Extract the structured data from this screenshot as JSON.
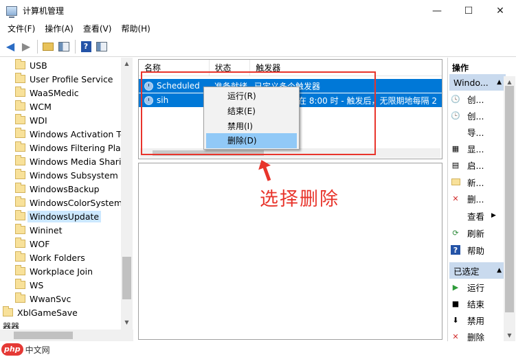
{
  "window": {
    "title": "计算机管理",
    "minimize_glyph": "—",
    "maximize_glyph": "☐",
    "close_glyph": "✕"
  },
  "menu": [
    "文件(F)",
    "操作(A)",
    "查看(V)",
    "帮助(H)"
  ],
  "toolbar": {
    "icons": [
      "back-arrow-icon",
      "forward-arrow-icon",
      "folder-up-icon",
      "show-hide-tree-icon",
      "help-icon",
      "properties-panel-icon"
    ],
    "help_glyph": "?"
  },
  "tree": {
    "items": [
      {
        "label": "USB"
      },
      {
        "label": "User Profile Service"
      },
      {
        "label": "WaaSMedic"
      },
      {
        "label": "WCM"
      },
      {
        "label": "WDI"
      },
      {
        "label": "Windows Activation Tec"
      },
      {
        "label": "Windows Filtering Platf"
      },
      {
        "label": "Windows Media Sharin"
      },
      {
        "label": "Windows Subsystem Fo"
      },
      {
        "label": "WindowsBackup"
      },
      {
        "label": "WindowsColorSystem"
      },
      {
        "label": "WindowsUpdate",
        "selected": true
      },
      {
        "label": "Wininet"
      },
      {
        "label": "WOF"
      },
      {
        "label": "Work Folders"
      },
      {
        "label": "Workplace Join"
      },
      {
        "label": "WS"
      },
      {
        "label": "WwanSvc"
      },
      {
        "label": "XblGameSave"
      }
    ],
    "cut_label": "器器"
  },
  "task_list": {
    "columns": [
      "名称",
      "状态",
      "触发器"
    ],
    "rows": [
      {
        "name": "Scheduled ...",
        "status": "准备就绪",
        "trigger": "已定义多个触发器"
      },
      {
        "name": "sih",
        "status": "",
        "trigger": "在 8:00 时 - 触发后，无限期地每隔 2"
      }
    ]
  },
  "context_menu": {
    "items": [
      {
        "label": "运行(R)"
      },
      {
        "label": "结束(E)"
      },
      {
        "label": "禁用(I)"
      },
      {
        "label": "删除(D)",
        "active": true
      }
    ]
  },
  "annotation": {
    "text": "选择删除",
    "color": "#e8342b"
  },
  "actions": {
    "title": "操作",
    "section1": {
      "header": "Windo...",
      "items": [
        {
          "label": "创...",
          "icon": "create-basic-task-icon"
        },
        {
          "label": "创...",
          "icon": "create-task-icon"
        },
        {
          "label": "导...",
          "icon": "import-icon"
        },
        {
          "label": "显...",
          "icon": "display-running-icon"
        },
        {
          "label": "启...",
          "icon": "enable-history-icon"
        },
        {
          "label": "新...",
          "icon": "new-folder-icon"
        },
        {
          "label": "删...",
          "icon": "delete-folder-icon"
        },
        {
          "label": "查看",
          "icon": "view-icon"
        },
        {
          "label": "刷新",
          "icon": "refresh-icon"
        },
        {
          "label": "帮助",
          "icon": "help-icon"
        }
      ]
    },
    "section2": {
      "header": "已选定",
      "items": [
        {
          "label": "运行",
          "icon": "run-icon"
        },
        {
          "label": "结束",
          "icon": "end-icon"
        },
        {
          "label": "禁用",
          "icon": "disable-icon"
        },
        {
          "label": "删除",
          "icon": "delete-icon"
        }
      ]
    }
  },
  "watermark": {
    "logo": "php",
    "text": "中文网"
  },
  "colors": {
    "selection": "#0078d7",
    "tree_selection": "#cce8ff",
    "action_header": "#c9daee",
    "context_active": "#91c9f7"
  }
}
